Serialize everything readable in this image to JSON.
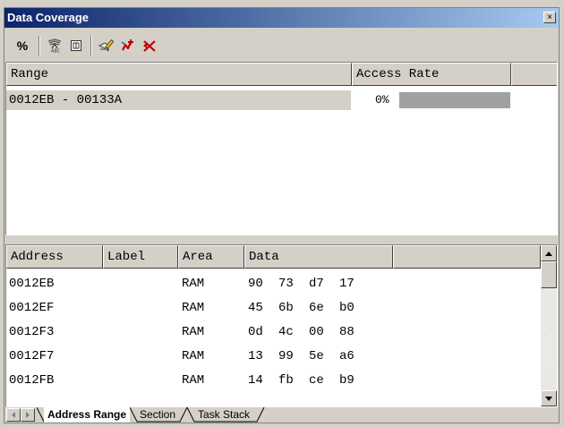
{
  "window": {
    "title": "Data Coverage",
    "close_label": "×"
  },
  "toolbar": {
    "icons": [
      "percent-icon",
      "address-range-icon",
      "section-icon",
      "edit-range-icon",
      "add-range-icon",
      "delete-range-icon"
    ],
    "percent_label": "%"
  },
  "range_table": {
    "headers": {
      "range": "Range",
      "access_rate": "Access Rate"
    },
    "rows": [
      {
        "range": "0012EB - 00133A",
        "rate": "0%",
        "rate_value": 0
      }
    ]
  },
  "data_table": {
    "headers": {
      "address": "Address",
      "label": "Label",
      "area": "Area",
      "data": "Data"
    },
    "rows": [
      {
        "address": "0012EB",
        "label": "",
        "area": "RAM",
        "bytes": [
          "90",
          "73",
          "d7",
          "17"
        ]
      },
      {
        "address": "0012EF",
        "label": "",
        "area": "RAM",
        "bytes": [
          "45",
          "6b",
          "6e",
          "b0"
        ]
      },
      {
        "address": "0012F3",
        "label": "",
        "area": "RAM",
        "bytes": [
          "0d",
          "4c",
          "00",
          "88"
        ]
      },
      {
        "address": "0012F7",
        "label": "",
        "area": "RAM",
        "bytes": [
          "13",
          "99",
          "5e",
          "a6"
        ]
      },
      {
        "address": "0012FB",
        "label": "",
        "area": "RAM",
        "bytes": [
          "14",
          "fb",
          "ce",
          "b9"
        ]
      }
    ]
  },
  "tabs": [
    {
      "label": "Address Range",
      "active": true
    },
    {
      "label": "Section",
      "active": false
    },
    {
      "label": "Task Stack",
      "active": false
    }
  ],
  "colors": {
    "title_start": "#0a246a",
    "title_end": "#a6caf0",
    "bar": "#a0a0a0",
    "face": "#d4d0c8"
  }
}
